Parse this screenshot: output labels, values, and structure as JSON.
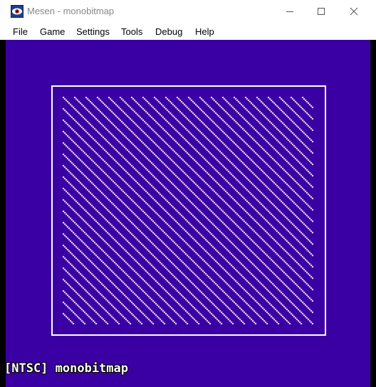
{
  "window": {
    "title": "Mesen - monobitmap",
    "minimize_icon": "minimize-icon",
    "maximize_icon": "maximize-icon",
    "close_icon": "close-icon"
  },
  "menu": {
    "items": [
      {
        "label": "File"
      },
      {
        "label": "Game"
      },
      {
        "label": "Settings"
      },
      {
        "label": "Tools"
      },
      {
        "label": "Debug"
      },
      {
        "label": "Help"
      }
    ]
  },
  "emulator": {
    "background_color": "#3b00a3",
    "foreground_color": "#ffffff",
    "osd_text": "[NTSC] monobitmap"
  }
}
